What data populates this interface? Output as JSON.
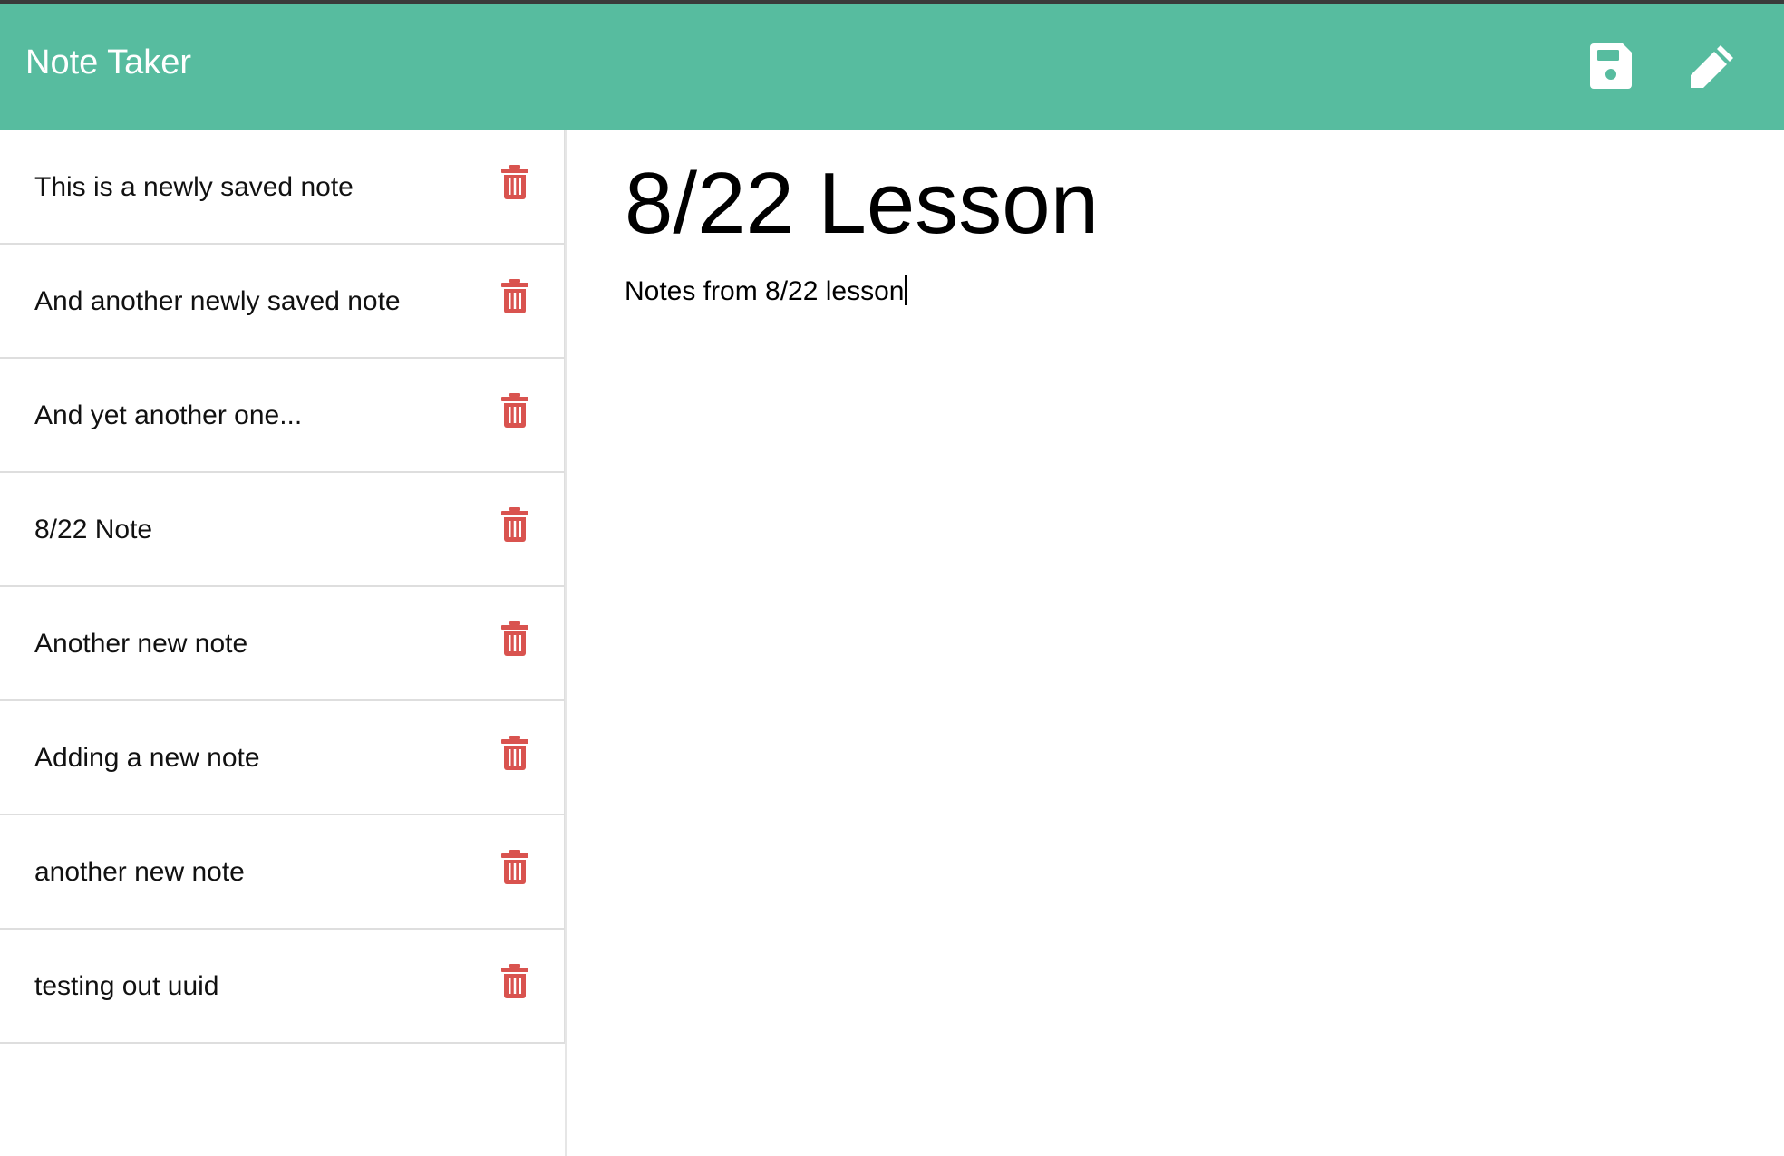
{
  "app": {
    "title": "Note Taker",
    "accent_color": "#57bc9f",
    "delete_color": "#d9534f"
  },
  "toolbar": {
    "save_icon": "floppy-disk-icon",
    "new_icon": "pencil-icon"
  },
  "sidebar": {
    "notes": [
      {
        "label": "This is a newly saved note"
      },
      {
        "label": "And another newly saved note"
      },
      {
        "label": "And yet another one..."
      },
      {
        "label": "8/22 Note"
      },
      {
        "label": "Another new note"
      },
      {
        "label": "Adding a new note"
      },
      {
        "label": "another new note"
      },
      {
        "label": "testing out uuid"
      }
    ],
    "delete_icon": "trash-icon"
  },
  "editor": {
    "title": "8/22 Lesson",
    "body": "Notes from 8/22 lesson"
  }
}
